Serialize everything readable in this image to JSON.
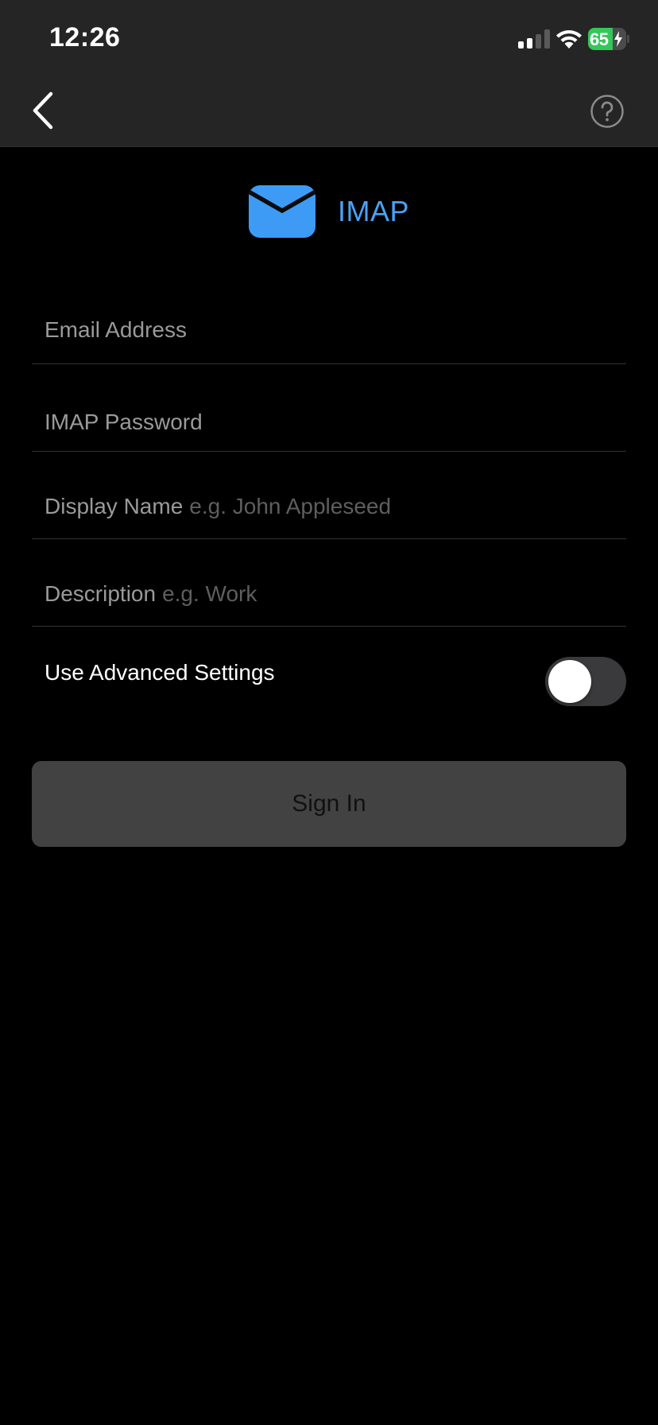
{
  "status_bar": {
    "time": "12:26",
    "battery_percent": "65",
    "battery_level": 0.65,
    "signal_bars_active": 2,
    "signal_bars_total": 4
  },
  "nav": {
    "back_icon": "chevron-left-icon",
    "help_icon": "question-circle-icon"
  },
  "header": {
    "icon": "envelope-icon",
    "title": "IMAP",
    "accent_color": "#3d9bf5"
  },
  "form": {
    "email": {
      "label": "Email Address",
      "placeholder": ""
    },
    "password": {
      "label": "IMAP Password",
      "placeholder": ""
    },
    "display_name": {
      "label": "Display Name",
      "placeholder": "e.g. John Appleseed"
    },
    "description": {
      "label": "Description",
      "placeholder": "e.g. Work"
    },
    "advanced": {
      "label": "Use Advanced Settings",
      "enabled": false
    }
  },
  "actions": {
    "sign_in_label": "Sign In"
  },
  "colors": {
    "background": "#000000",
    "nav_background": "#252525",
    "button_background": "#424242",
    "toggle_off": "#3a3a3c",
    "battery_green": "#34c759"
  }
}
